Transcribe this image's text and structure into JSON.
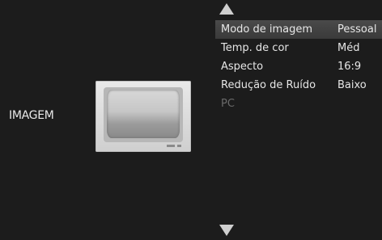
{
  "section": {
    "title": "IMAGEM"
  },
  "menu": {
    "items": [
      {
        "label": "Modo de imagem",
        "value": "Pessoal"
      },
      {
        "label": "Temp. de cor",
        "value": "Méd"
      },
      {
        "label": "Aspecto",
        "value": "16:9"
      },
      {
        "label": "Redução de Ruído",
        "value": "Baixo"
      },
      {
        "label": "PC",
        "value": ""
      }
    ]
  },
  "icons": {
    "tv": "tv-icon",
    "scroll_up": "arrow-up-icon",
    "scroll_down": "arrow-down-icon"
  }
}
